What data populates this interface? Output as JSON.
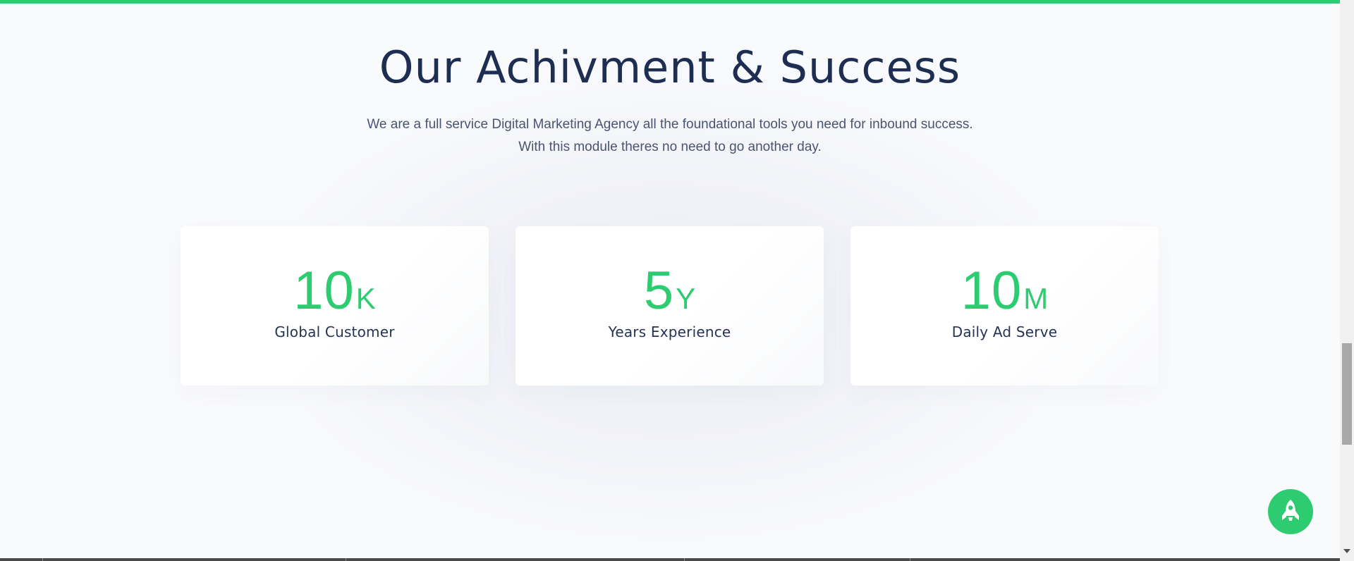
{
  "colors": {
    "accent": "#2ecc71",
    "heading": "#1e2d52",
    "body_text": "#4a5470",
    "background": "#f7f8fb",
    "card": "#ffffff"
  },
  "section": {
    "title": "Our Achivment & Success",
    "description": "We are a full service Digital Marketing Agency all the foundational tools you need for inbound success. With this module theres no need to go another day."
  },
  "stats": [
    {
      "number": "10",
      "suffix": "K",
      "label": "Global Customer"
    },
    {
      "number": "5",
      "suffix": "Y",
      "label": "Years Experience"
    },
    {
      "number": "10",
      "suffix": "M",
      "label": "Daily Ad Serve"
    }
  ],
  "back_to_top": {
    "icon": "rocket-icon"
  }
}
